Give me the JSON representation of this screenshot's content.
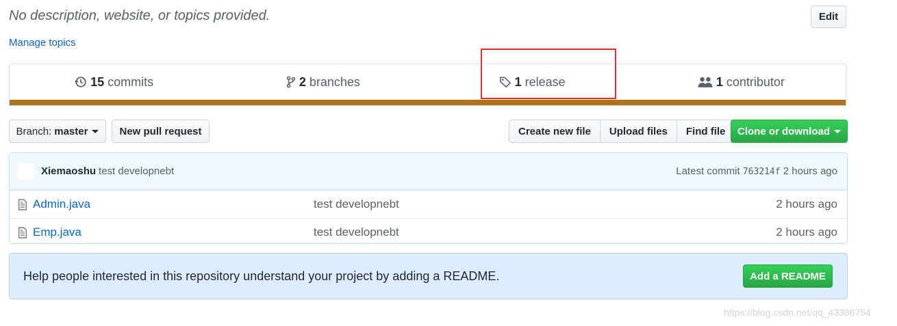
{
  "repo": {
    "description": "No description, website, or topics provided.",
    "edit_label": "Edit",
    "manage_topics": "Manage topics"
  },
  "summary": {
    "commits_count": "15",
    "commits_label": "commits",
    "branches_count": "2",
    "branches_label": "branches",
    "releases_count": "1",
    "releases_label": "release",
    "contributors_count": "1",
    "contributors_label": "contributor",
    "language_bar_color": "#b07219",
    "highlight_color": "#e5302f"
  },
  "toolbar": {
    "branch_prefix": "Branch:",
    "branch_name": "master",
    "new_pull_request": "New pull request",
    "create_new_file": "Create new file",
    "upload_files": "Upload files",
    "find_file": "Find file",
    "clone_or_download": "Clone or download"
  },
  "latest_commit": {
    "author": "Xiemaoshu",
    "message": "test developnebt",
    "latest_prefix": "Latest commit",
    "sha": "763214f",
    "age": "2 hours ago"
  },
  "files": [
    {
      "name": "Admin.java",
      "message": "test developnebt",
      "age": "2 hours ago"
    },
    {
      "name": "Emp.java",
      "message": "test developnebt",
      "age": "2 hours ago"
    }
  ],
  "readme": {
    "prompt": "Help people interested in this repository understand your project by adding a README.",
    "button": "Add a README"
  },
  "watermark": "https://blog.csdn.net/qq_43386754",
  "icons": {
    "commits": "history-icon",
    "branches": "git-branch-icon",
    "releases": "tag-icon",
    "contributors": "people-icon",
    "file": "file-icon"
  }
}
